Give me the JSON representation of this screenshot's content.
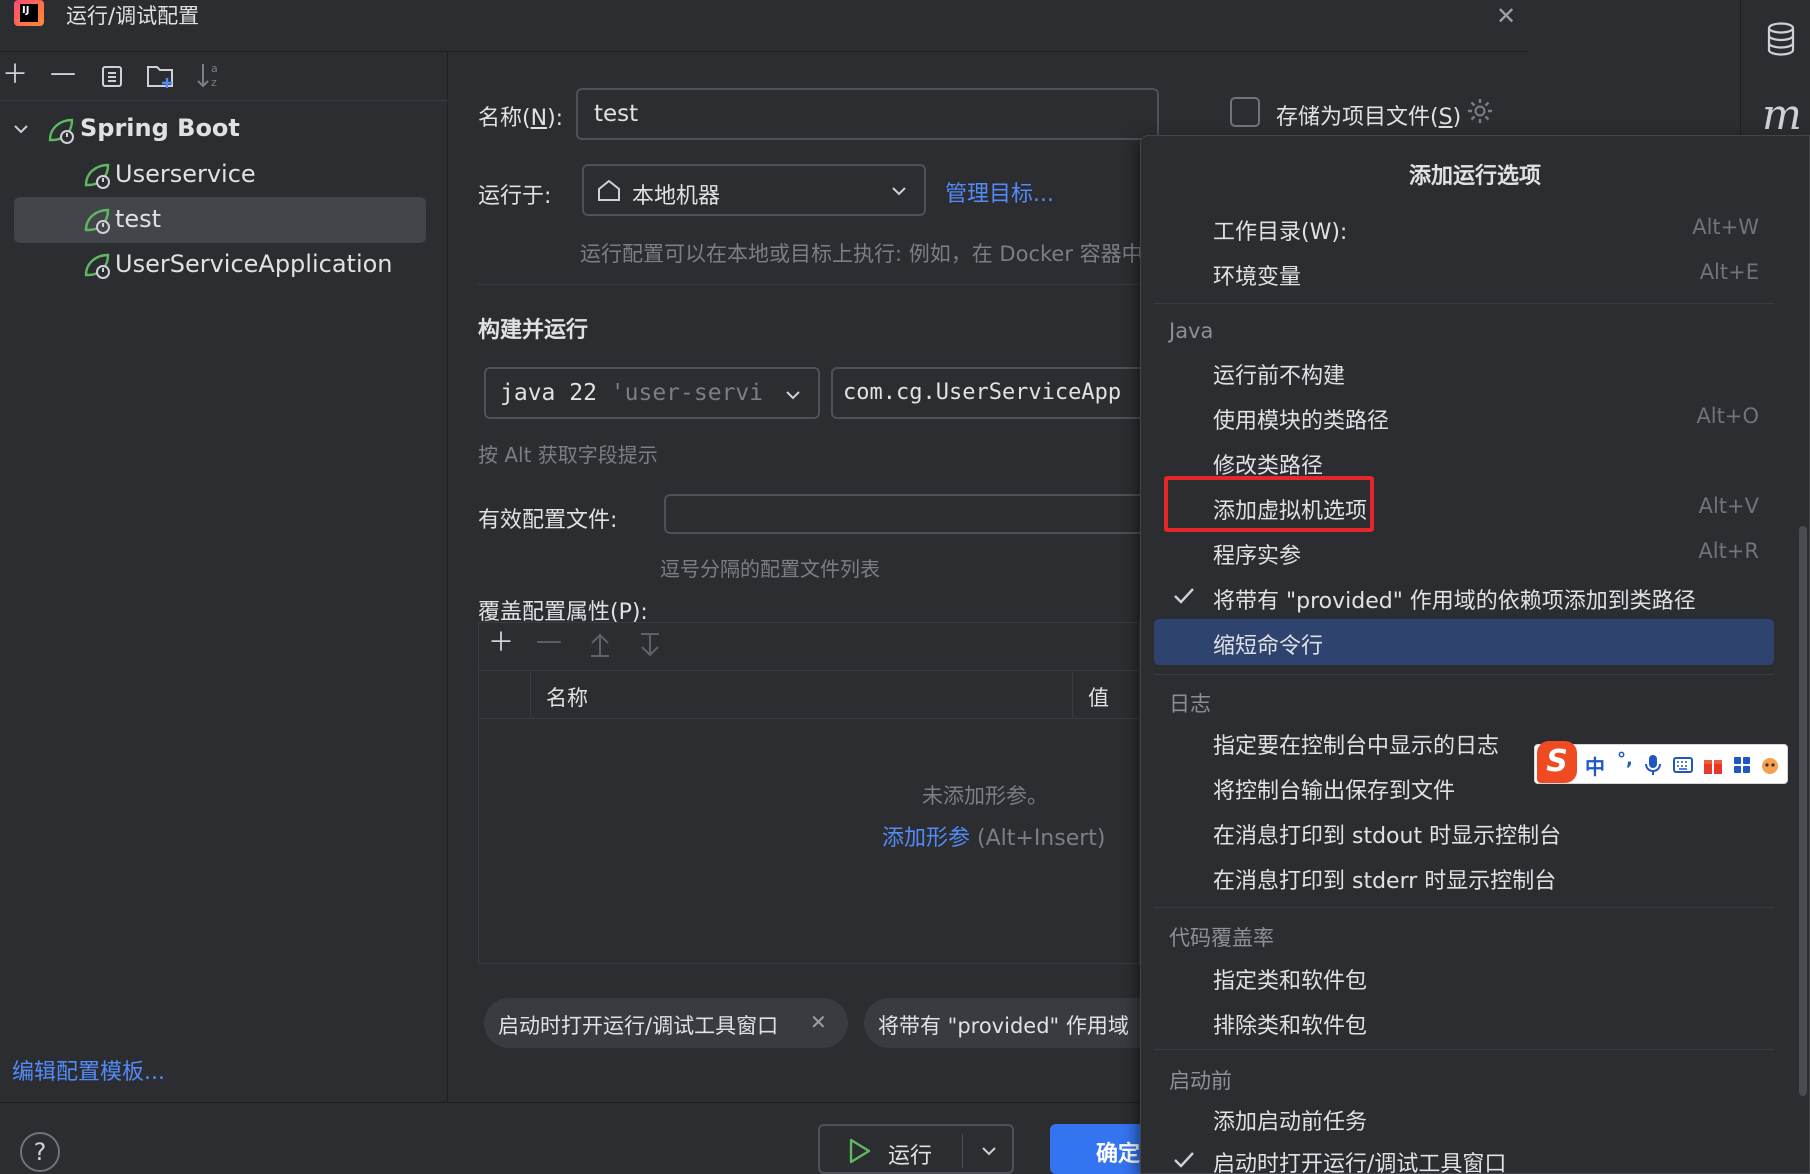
{
  "window": {
    "title": "运行/调试配置",
    "logo_text": "IJ"
  },
  "tree": {
    "root": {
      "label": "Spring Boot"
    },
    "items": [
      {
        "label": "Userservice"
      },
      {
        "label": "test",
        "selected": true
      },
      {
        "label": "UserServiceApplication"
      }
    ]
  },
  "left_footer": {
    "edit_templates": "编辑配置模板..."
  },
  "form": {
    "name_label_prefix": "名称(",
    "name_label_key": "N",
    "name_label_suffix": "):",
    "name_value": "test",
    "store_prefix": "存储为项目文件(",
    "store_key": "S",
    "store_suffix": ")",
    "run_on_label": "运行于:",
    "run_on_value": "本地机器",
    "manage_targets": "管理目标...",
    "run_on_hint": "运行配置可以在本地或目标上执行: 例如，在 Docker 容器中",
    "build_section": "构建并运行",
    "jdk_prefix": "java 22",
    "jdk_module": "'user-servi",
    "main_class": "com.cg.UserServiceApp",
    "alt_hint": "按 Alt 获取字段提示",
    "profiles_label": "有效配置文件:",
    "profiles_hint": "逗号分隔的配置文件列表",
    "override_label": "覆盖配置属性(P):",
    "table_col_name": "名称",
    "table_col_value": "值",
    "table_empty": "未添加形参。",
    "table_add_link": "添加形参",
    "table_add_shortcut": "(Alt+Insert)",
    "chip1": "启动时打开运行/调试工具窗口",
    "chip2": "将带有 \"provided\" 作用域"
  },
  "bottom": {
    "help": "?",
    "run_label": "运行",
    "ok_label": "确定"
  },
  "popup": {
    "title": "添加运行选项",
    "items_top": [
      {
        "label": "工作目录(W):",
        "shortcut": "Alt+W"
      },
      {
        "label": "环境变量",
        "shortcut": "Alt+E"
      }
    ],
    "group_java": "Java",
    "items_java": [
      {
        "label": "运行前不构建",
        "shortcut": ""
      },
      {
        "label": "使用模块的类路径",
        "shortcut": "Alt+O"
      },
      {
        "label": "修改类路径",
        "shortcut": ""
      },
      {
        "label": "添加虚拟机选项",
        "shortcut": "Alt+V"
      },
      {
        "label": "程序实参",
        "shortcut": "Alt+R"
      },
      {
        "label": "将带有 \"provided\" 作用域的依赖项添加到类路径",
        "shortcut": "",
        "checked": true
      },
      {
        "label": "缩短命令行",
        "shortcut": "",
        "highlighted": true
      }
    ],
    "group_log": "日志",
    "items_log": [
      {
        "label": "指定要在控制台中显示的日志"
      },
      {
        "label": "将控制台输出保存到文件"
      },
      {
        "label": "在消息打印到 stdout 时显示控制台"
      },
      {
        "label": "在消息打印到 stderr 时显示控制台"
      }
    ],
    "group_coverage": "代码覆盖率",
    "items_coverage": [
      {
        "label": "指定类和软件包"
      },
      {
        "label": "排除类和软件包"
      }
    ],
    "group_before": "启动前",
    "items_before": [
      {
        "label": "添加启动前任务"
      },
      {
        "label": "启动时打开运行/调试工具窗口",
        "checked": true
      }
    ]
  },
  "ime": {
    "brand": "S",
    "lang": "中",
    "punct": "°,"
  },
  "colors": {
    "accent": "#3574f0",
    "link": "#548af7",
    "highlight": "#2e436e",
    "annotation": "#e5262b",
    "spring_green": "#5fb760"
  }
}
